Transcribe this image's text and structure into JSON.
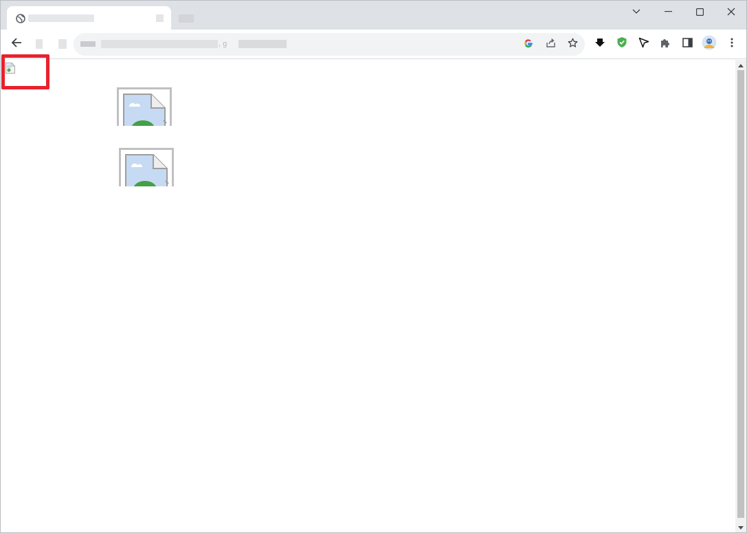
{
  "browser": {
    "tab": {
      "icon": "globe-icon"
    },
    "window_controls": [
      "chevron-down-icon",
      "minimize-icon",
      "maximize-icon",
      "close-icon"
    ],
    "toolbar": {
      "back_icon": "back-arrow-icon",
      "address_fragment": ", g",
      "omnibox_icons": [
        "google-icon",
        "share-icon",
        "star-icon"
      ],
      "extension_icons": [
        "download-shield-icon",
        "green-shield-icon",
        "cursor-arrow-icon",
        "puzzle-icon",
        "side-panel-icon",
        "avatar-icon",
        "more-menu-icon"
      ]
    }
  },
  "content": {
    "broken_images": [
      "broken-image-icon",
      "broken-image-icon"
    ],
    "highlight": {
      "color": "#e8212d"
    }
  },
  "colors": {
    "tabstrip_bg": "#dee1e6",
    "omnibox_bg": "#f1f3f4",
    "accent_green": "#4caf50",
    "highlight_red": "#e8212d"
  }
}
